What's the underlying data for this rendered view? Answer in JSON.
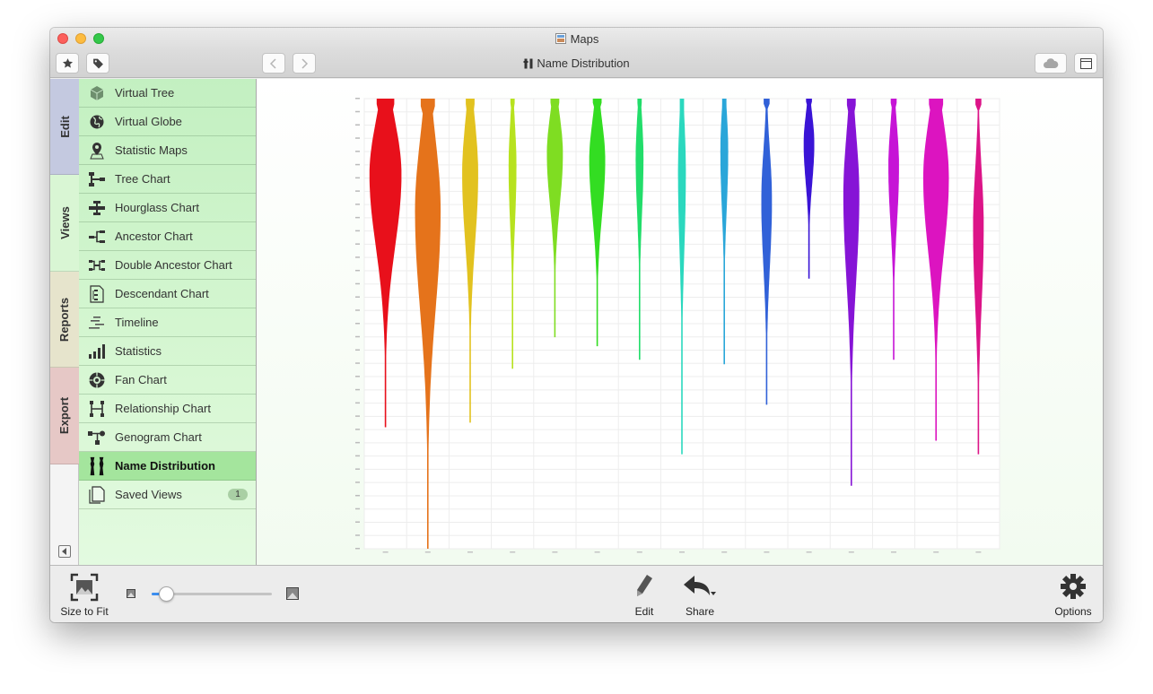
{
  "window": {
    "title": "Maps"
  },
  "toolbar": {
    "title": "Name Distribution"
  },
  "vtabs": [
    {
      "label": "Edit",
      "color": "#c4c9e0"
    },
    {
      "label": "Views",
      "color": "#d9f6d4"
    },
    {
      "label": "Reports",
      "color": "#e6e4cc"
    },
    {
      "label": "Export",
      "color": "#e6c8c6"
    }
  ],
  "sidebar": {
    "items": [
      {
        "label": "Virtual Tree",
        "icon": "cube-icon"
      },
      {
        "label": "Virtual Globe",
        "icon": "globe-icon"
      },
      {
        "label": "Statistic Maps",
        "icon": "map-pin-icon"
      },
      {
        "label": "Tree Chart",
        "icon": "tree-chart-icon"
      },
      {
        "label": "Hourglass Chart",
        "icon": "hourglass-chart-icon"
      },
      {
        "label": "Ancestor Chart",
        "icon": "ancestor-chart-icon"
      },
      {
        "label": "Double Ancestor Chart",
        "icon": "double-ancestor-chart-icon"
      },
      {
        "label": "Descendant Chart",
        "icon": "descendant-chart-icon"
      },
      {
        "label": "Timeline",
        "icon": "timeline-icon"
      },
      {
        "label": "Statistics",
        "icon": "bar-stats-icon"
      },
      {
        "label": "Fan Chart",
        "icon": "fan-chart-icon"
      },
      {
        "label": "Relationship Chart",
        "icon": "relationship-chart-icon"
      },
      {
        "label": "Genogram Chart",
        "icon": "genogram-icon"
      },
      {
        "label": "Name Distribution",
        "icon": "name-distribution-icon",
        "selected": true
      },
      {
        "label": "Saved Views",
        "icon": "saved-views-icon",
        "badge": "1"
      }
    ]
  },
  "bottombar": {
    "size_to_fit": "Size to Fit",
    "edit": "Edit",
    "share": "Share",
    "options": "Options",
    "zoom_level": 0.12
  },
  "chart_data": {
    "type": "violin",
    "title": "",
    "series": [
      {
        "color": "#e8101b",
        "length": 0.73,
        "peak": 0.23,
        "width": 0.9
      },
      {
        "color": "#e5731b",
        "length": 1.0,
        "peak": 0.25,
        "width": 0.72
      },
      {
        "color": "#e2c21f",
        "length": 0.72,
        "peak": 0.23,
        "width": 0.45
      },
      {
        "color": "#b7e21f",
        "length": 0.6,
        "peak": 0.25,
        "width": 0.22
      },
      {
        "color": "#7fdd22",
        "length": 0.53,
        "peak": 0.23,
        "width": 0.45
      },
      {
        "color": "#33dd22",
        "length": 0.55,
        "peak": 0.25,
        "width": 0.45
      },
      {
        "color": "#22dd6a",
        "length": 0.58,
        "peak": 0.23,
        "width": 0.22
      },
      {
        "color": "#2bd8be",
        "length": 0.79,
        "peak": 0.21,
        "width": 0.22
      },
      {
        "color": "#2aa6d9",
        "length": 0.59,
        "peak": 0.2,
        "width": 0.22
      },
      {
        "color": "#3161d8",
        "length": 0.68,
        "peak": 0.33,
        "width": 0.3
      },
      {
        "color": "#3a14d6",
        "length": 0.4,
        "peak": 0.25,
        "width": 0.3
      },
      {
        "color": "#8614d6",
        "length": 0.86,
        "peak": 0.25,
        "width": 0.45
      },
      {
        "color": "#c614d6",
        "length": 0.58,
        "peak": 0.26,
        "width": 0.3
      },
      {
        "color": "#dc14c0",
        "length": 0.76,
        "peak": 0.23,
        "width": 0.72
      },
      {
        "color": "#dc1488",
        "length": 0.79,
        "peak": 0.36,
        "width": 0.3
      }
    ]
  }
}
